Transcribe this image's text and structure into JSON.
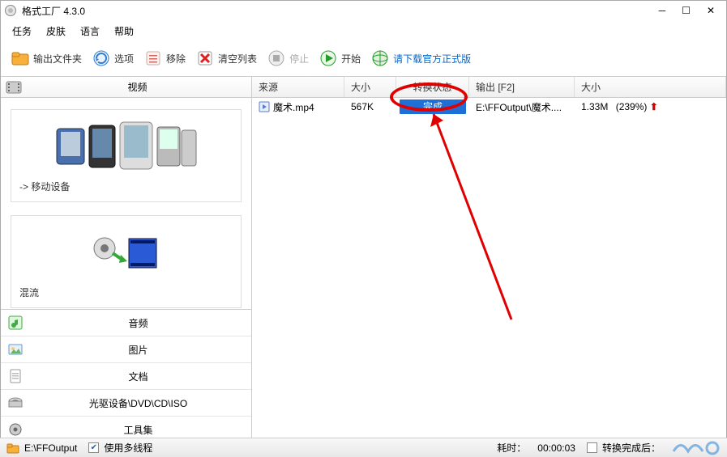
{
  "window": {
    "title": "格式工厂 4.3.0"
  },
  "menu": {
    "task": "任务",
    "skin": "皮肤",
    "language": "语言",
    "help": "帮助"
  },
  "toolbar": {
    "output_folder": "输出文件夹",
    "options": "选项",
    "remove": "移除",
    "clear_list": "清空列表",
    "stop": "停止",
    "start": "开始",
    "download_link": "请下载官方正式版"
  },
  "left": {
    "video_title": "视频",
    "card_mobile": "-> 移动设备",
    "card_mux": "混流",
    "cats": {
      "audio": "音频",
      "picture": "图片",
      "document": "文档",
      "optical": "光驱设备\\DVD\\CD\\ISO",
      "toolset": "工具集"
    }
  },
  "table": {
    "head": {
      "source": "来源",
      "size": "大小",
      "status": "转换状态",
      "output": "输出 [F2]",
      "size2": "大小"
    },
    "rows": [
      {
        "file": "魔术.mp4",
        "size": "567K",
        "status": "完成",
        "output": "E:\\FFOutput\\魔术....",
        "size2": "1.33M",
        "ratio": "(239%)"
      }
    ]
  },
  "status": {
    "path": "E:\\FFOutput",
    "multithread": "使用多线程",
    "elapsed_label": "耗时：",
    "elapsed": "00:00:03",
    "after_convert": "转换完成后："
  }
}
